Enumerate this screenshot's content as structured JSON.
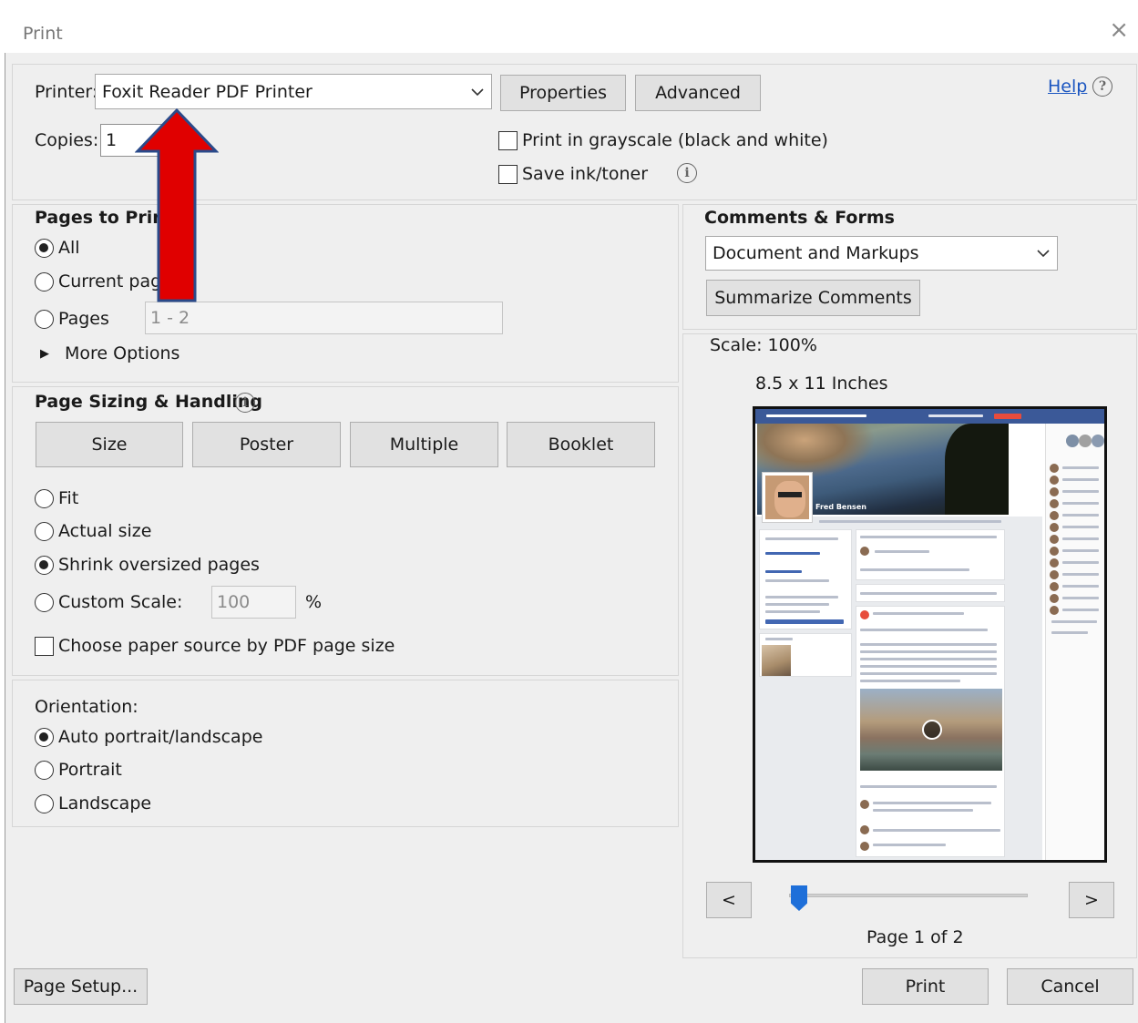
{
  "window": {
    "title": "Print",
    "close_glyph": "×"
  },
  "printer": {
    "label": "Printer:",
    "selected": "Foxit Reader PDF Printer",
    "properties_button": "Properties",
    "advanced_button": "Advanced",
    "help_link": "Help",
    "copies_label": "Copies:",
    "copies_value": "1",
    "grayscale_label": "Print in grayscale (black and white)",
    "grayscale_checked": false,
    "save_ink_label": "Save ink/toner",
    "save_ink_checked": false
  },
  "pages_to_print": {
    "heading": "Pages to Print",
    "options": [
      {
        "label": "All",
        "selected": true
      },
      {
        "label": "Current pag",
        "selected": false
      },
      {
        "label": "Pages",
        "selected": false
      }
    ],
    "pages_range": "1 - 2",
    "more_options": "More Options"
  },
  "page_sizing": {
    "heading": "Page Sizing & Handling",
    "mode_buttons": [
      "Size",
      "Poster",
      "Multiple",
      "Booklet"
    ],
    "options": [
      {
        "label": "Fit",
        "selected": false
      },
      {
        "label": "Actual size",
        "selected": false
      },
      {
        "label": "Shrink oversized pages",
        "selected": true
      },
      {
        "label": "Custom Scale:",
        "selected": false
      }
    ],
    "custom_scale_value": "100",
    "custom_scale_unit": "%",
    "paper_source_label": "Choose paper source by PDF page size",
    "paper_source_checked": false
  },
  "orientation": {
    "heading": "Orientation:",
    "options": [
      {
        "label": "Auto portrait/landscape",
        "selected": true
      },
      {
        "label": "Portrait",
        "selected": false
      },
      {
        "label": "Landscape",
        "selected": false
      }
    ]
  },
  "comments_forms": {
    "heading": "Comments & Forms",
    "selected": "Document and Markups",
    "summarize_button": "Summarize Comments"
  },
  "preview": {
    "scale": "Scale: 100%",
    "paper_size": "8.5 x 11 Inches",
    "fb_name": "Fred Bensen",
    "prev_button": "<",
    "next_button": ">",
    "page_indicator": "Page 1 of 2",
    "page_slider_fraction": 0.0
  },
  "footer": {
    "page_setup_button": "Page Setup...",
    "print_button": "Print",
    "cancel_button": "Cancel"
  },
  "colors": {
    "annotation_arrow": "#e00000",
    "annotation_arrow_outline": "#2a4a8a",
    "slider_thumb": "#1e6fd9",
    "link": "#1a55c0"
  },
  "icons": {
    "dropdown": "chevron-down-icon",
    "help": "question-circle-icon",
    "info": "info-circle-icon",
    "expand": "triangle-right-icon",
    "close": "close-icon"
  }
}
